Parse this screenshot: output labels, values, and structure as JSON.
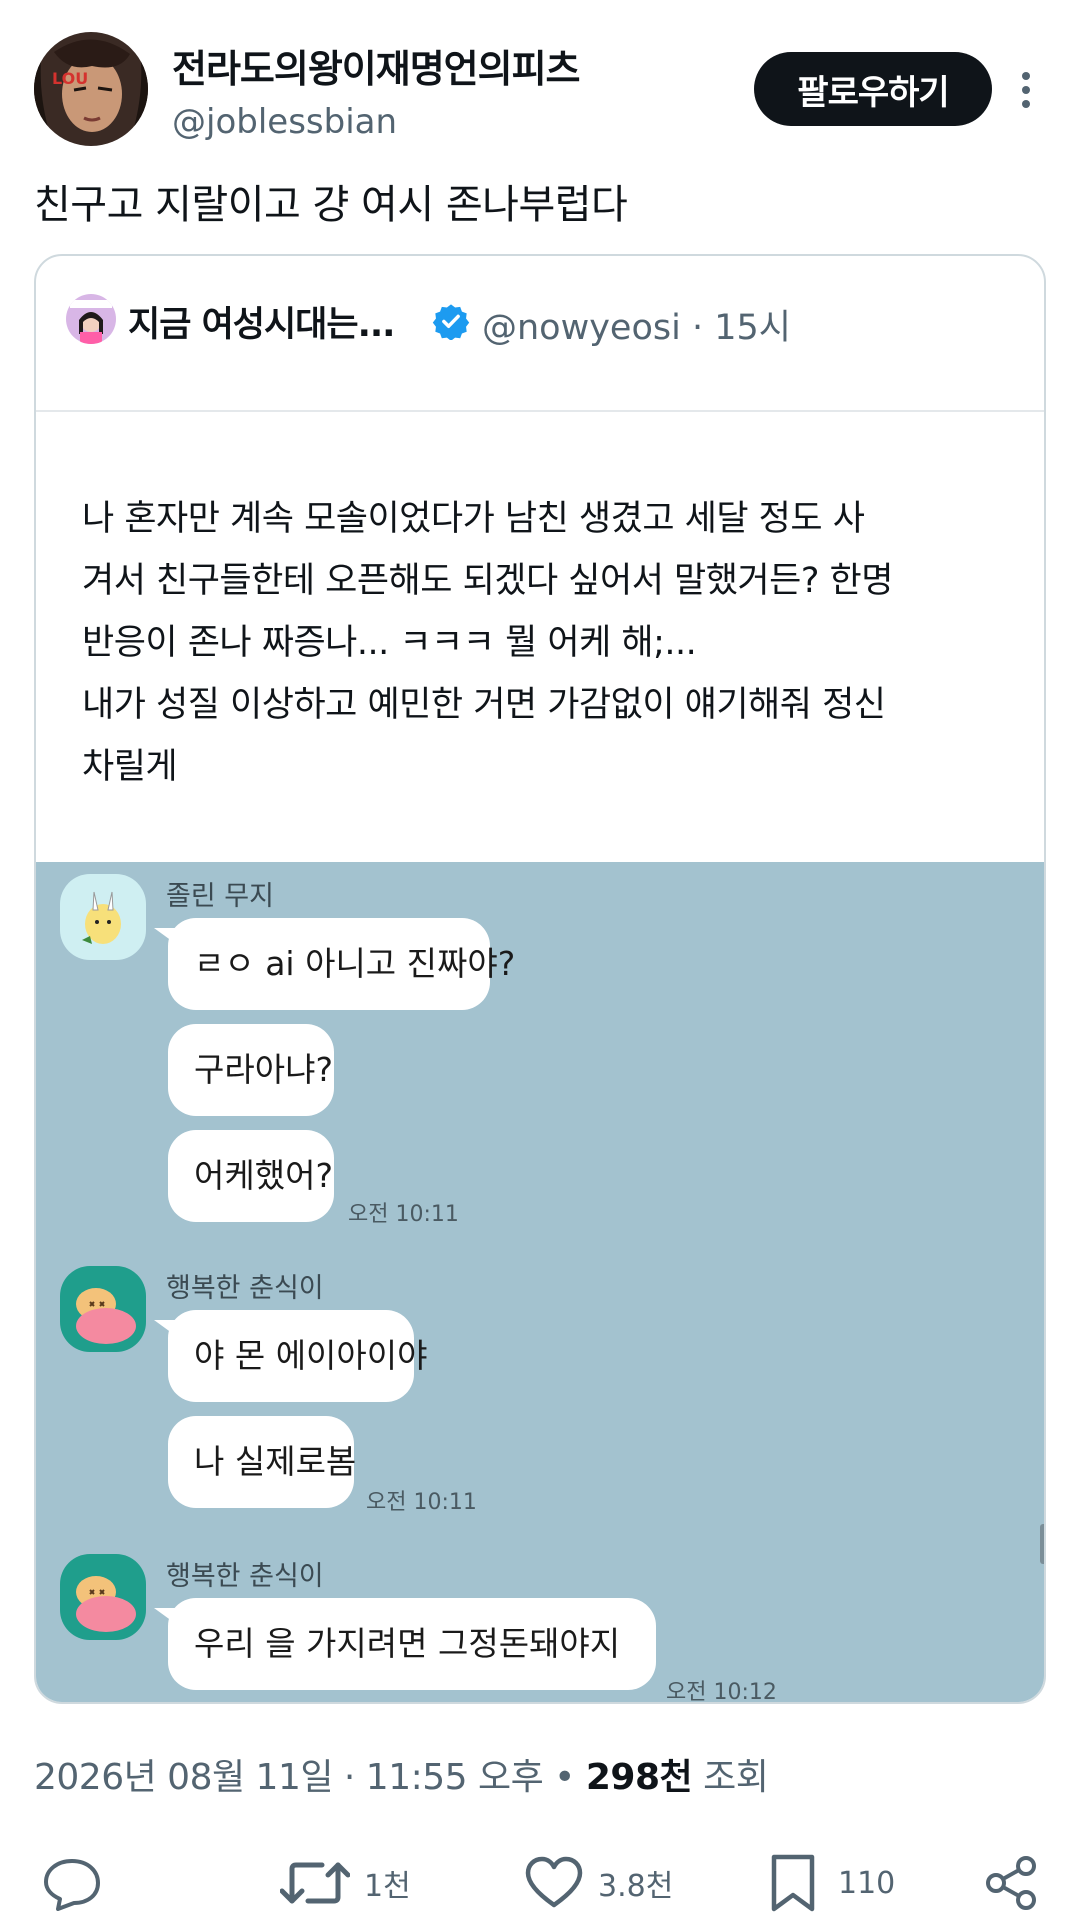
{
  "author": {
    "name": "전라도의왕이재명언의피츠",
    "handle": "@joblessbian",
    "follow_label": "팔로우하기",
    "avatar_text": "LOU"
  },
  "tweet_text": "친구고 지랄이고 걍 여시 존나부럽다",
  "quote": {
    "name": "지금 여성시대는...",
    "handle_time": "@nowyeosi · 15시",
    "body_lines": [
      "나 혼자만 계속 모솔이었다가 남친 생겼고 세달 정도 사",
      "겨서 친구들한테 오픈해도 되겠다 싶어서 말했거든? 한명",
      "반응이 존나 짜증나... ㅋㅋㅋ 뭘 어케 해;...",
      "내가 성질 이상하고 예민한 거면 가감없이 얘기해줘 정신",
      "차릴게"
    ],
    "chat": {
      "groups": [
        {
          "sender": "졸린 무지",
          "messages": [
            "ㄹㅇ ai 아니고 진짜야?",
            "구라아냐?",
            "어케했어?"
          ],
          "time": "오전 10:11"
        },
        {
          "sender": "행복한 춘식이",
          "messages": [
            "야 몬 에이아이야",
            "나 실제로봄"
          ],
          "time": "오전 10:11"
        },
        {
          "sender": "행복한 춘식이",
          "messages": [
            "우리          을 가지려면 그정돈돼야지"
          ],
          "time": "오전 10:12"
        }
      ]
    }
  },
  "meta": {
    "date_time": "2026년 08월 11일 · 11:55 오후 • ",
    "views_count": "298천",
    "views_label": " 조회"
  },
  "actions": {
    "retweets": "1천",
    "likes": "3.8천",
    "bookmarks": "110"
  },
  "colors": {
    "follow_button_bg": "#0f1419",
    "verified_badge": "#1d9bf0",
    "chat_background": "#a3c2cf",
    "secondary_text": "#536471"
  }
}
